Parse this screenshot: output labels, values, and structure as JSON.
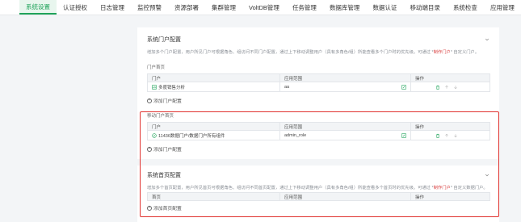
{
  "nav": {
    "items": [
      "系统设置",
      "认证授权",
      "日志管理",
      "监控预警",
      "资源部署",
      "集群管理",
      "VoltDB管理",
      "任务管理",
      "数据库管理",
      "数据认证",
      "移动端目录",
      "系统检查",
      "应用管理"
    ],
    "active_index": 0
  },
  "portal_section": {
    "title": "系统门户配置",
    "desc_prefix": "增加多个门户配置，用户所见门户可根据角色、组访问不同门户配置，通过上下移动调整用户（具有多角色/组）所能查看多个门户时的优先级。可通过 *",
    "desc_highlight": "制作门户",
    "desc_suffix": "* 自定义门户。",
    "pc_label": "门户首页",
    "columns": [
      "门户",
      "应用范围",
      "操作"
    ],
    "rows": [
      {
        "portal": "多度销售分析",
        "scope": "aa"
      }
    ],
    "add_label": "添加门户配置"
  },
  "mobile_section": {
    "label": "移动门户首页",
    "columns": [
      "门户",
      "应用范围",
      "操作"
    ],
    "rows": [
      {
        "portal": "11436数据门户/数据门户所有组件",
        "scope": "admin_role"
      }
    ],
    "add_label": "添加门户配置"
  },
  "home_section": {
    "title": "系统首页配置",
    "desc_prefix": "增加多个首页配置，用户所见首页可根据角色、组访问不同首页配置，通过上下移动调整用户（具有多角色/组）所能查看多个首页时的优先级。可通过 *",
    "desc_highlight": "制作门户",
    "desc_suffix": "* 自定义数据门户。",
    "columns": [
      "首页",
      "应用范围",
      "操作"
    ],
    "add_label": "添加首页配置"
  },
  "colors": {
    "accent": "#1fa35a",
    "highlight_border": "#e0322f"
  }
}
